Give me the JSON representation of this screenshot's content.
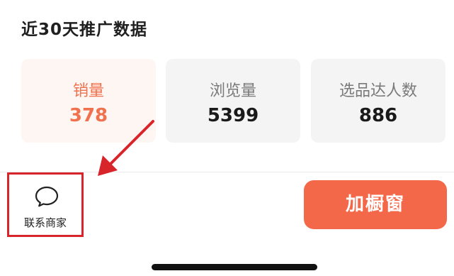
{
  "section": {
    "title": "近30天推广数据"
  },
  "stats": [
    {
      "label": "销量",
      "value": "378",
      "active": true
    },
    {
      "label": "浏览量",
      "value": "5399",
      "active": false
    },
    {
      "label": "选品达人数",
      "value": "886",
      "active": false
    }
  ],
  "bottom_bar": {
    "contact_label": "联系商家",
    "contact_icon": "chat-bubble-icon",
    "add_button_label": "加橱窗"
  },
  "colors": {
    "accent": "#f0714d",
    "button": "#f4684a",
    "annotation": "#d8242b"
  }
}
